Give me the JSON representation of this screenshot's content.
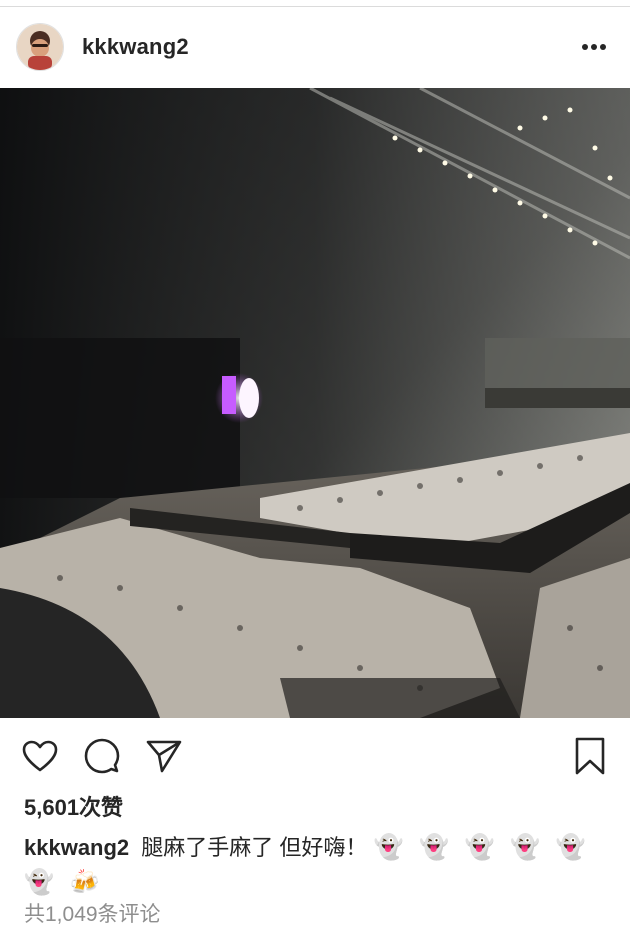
{
  "post": {
    "username": "kkkwang2",
    "likes_text": "5,601次赞",
    "caption_text": "腿麻了手麻了 但好嗨！",
    "caption_emojis": "👻 👻 👻 👻 👻 👻 🍻",
    "comments_text": "共1,049条评论"
  },
  "icons": {
    "avatar": "avatar",
    "more": "more-horizontal-icon",
    "like": "heart-icon",
    "comment": "comment-icon",
    "share": "send-icon",
    "save": "bookmark-icon"
  },
  "colors": {
    "text": "#262626",
    "muted": "#8e8e8e",
    "divider": "#dbdbdb"
  }
}
